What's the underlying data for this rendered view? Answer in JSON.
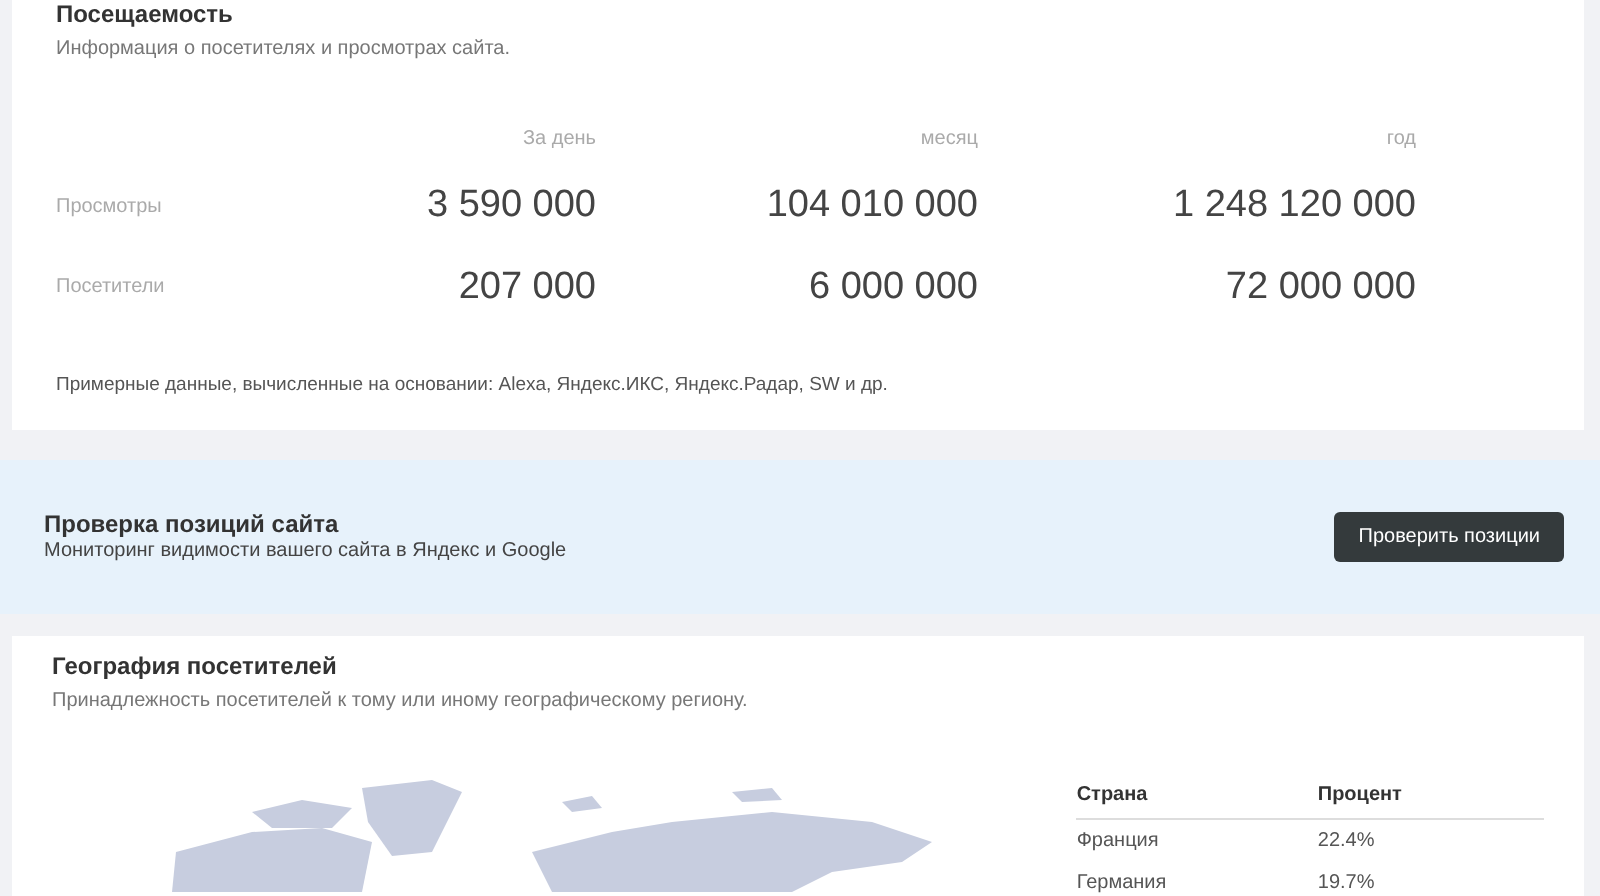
{
  "traffic": {
    "title": "Посещаемость",
    "subtitle": "Информация о посетителях и просмотрах сайта.",
    "columns": [
      "За день",
      "месяц",
      "год"
    ],
    "rows": [
      {
        "label": "Просмотры",
        "values": [
          "3 590 000",
          "104 010 000",
          "1 248 120 000"
        ]
      },
      {
        "label": "Посетители",
        "values": [
          "207 000",
          "6 000 000",
          "72 000 000"
        ]
      }
    ],
    "note": "Примерные данные, вычисленные на основании: Alexa, Яндекс.ИКС, Яндекс.Радар, SW и др."
  },
  "positions": {
    "title": "Проверка позиций сайта",
    "subtitle": "Мониторинг видимости вашего сайта в Яндекс и Google",
    "button": "Проверить позиции"
  },
  "geography": {
    "title": "География посетителей",
    "subtitle": "Принадлежность посетителей к тому или иному географическому региону.",
    "columns": [
      "Страна",
      "Процент"
    ],
    "rows": [
      {
        "country": "Франция",
        "percent": "22.4%"
      },
      {
        "country": "Германия",
        "percent": "19.7%"
      }
    ]
  }
}
